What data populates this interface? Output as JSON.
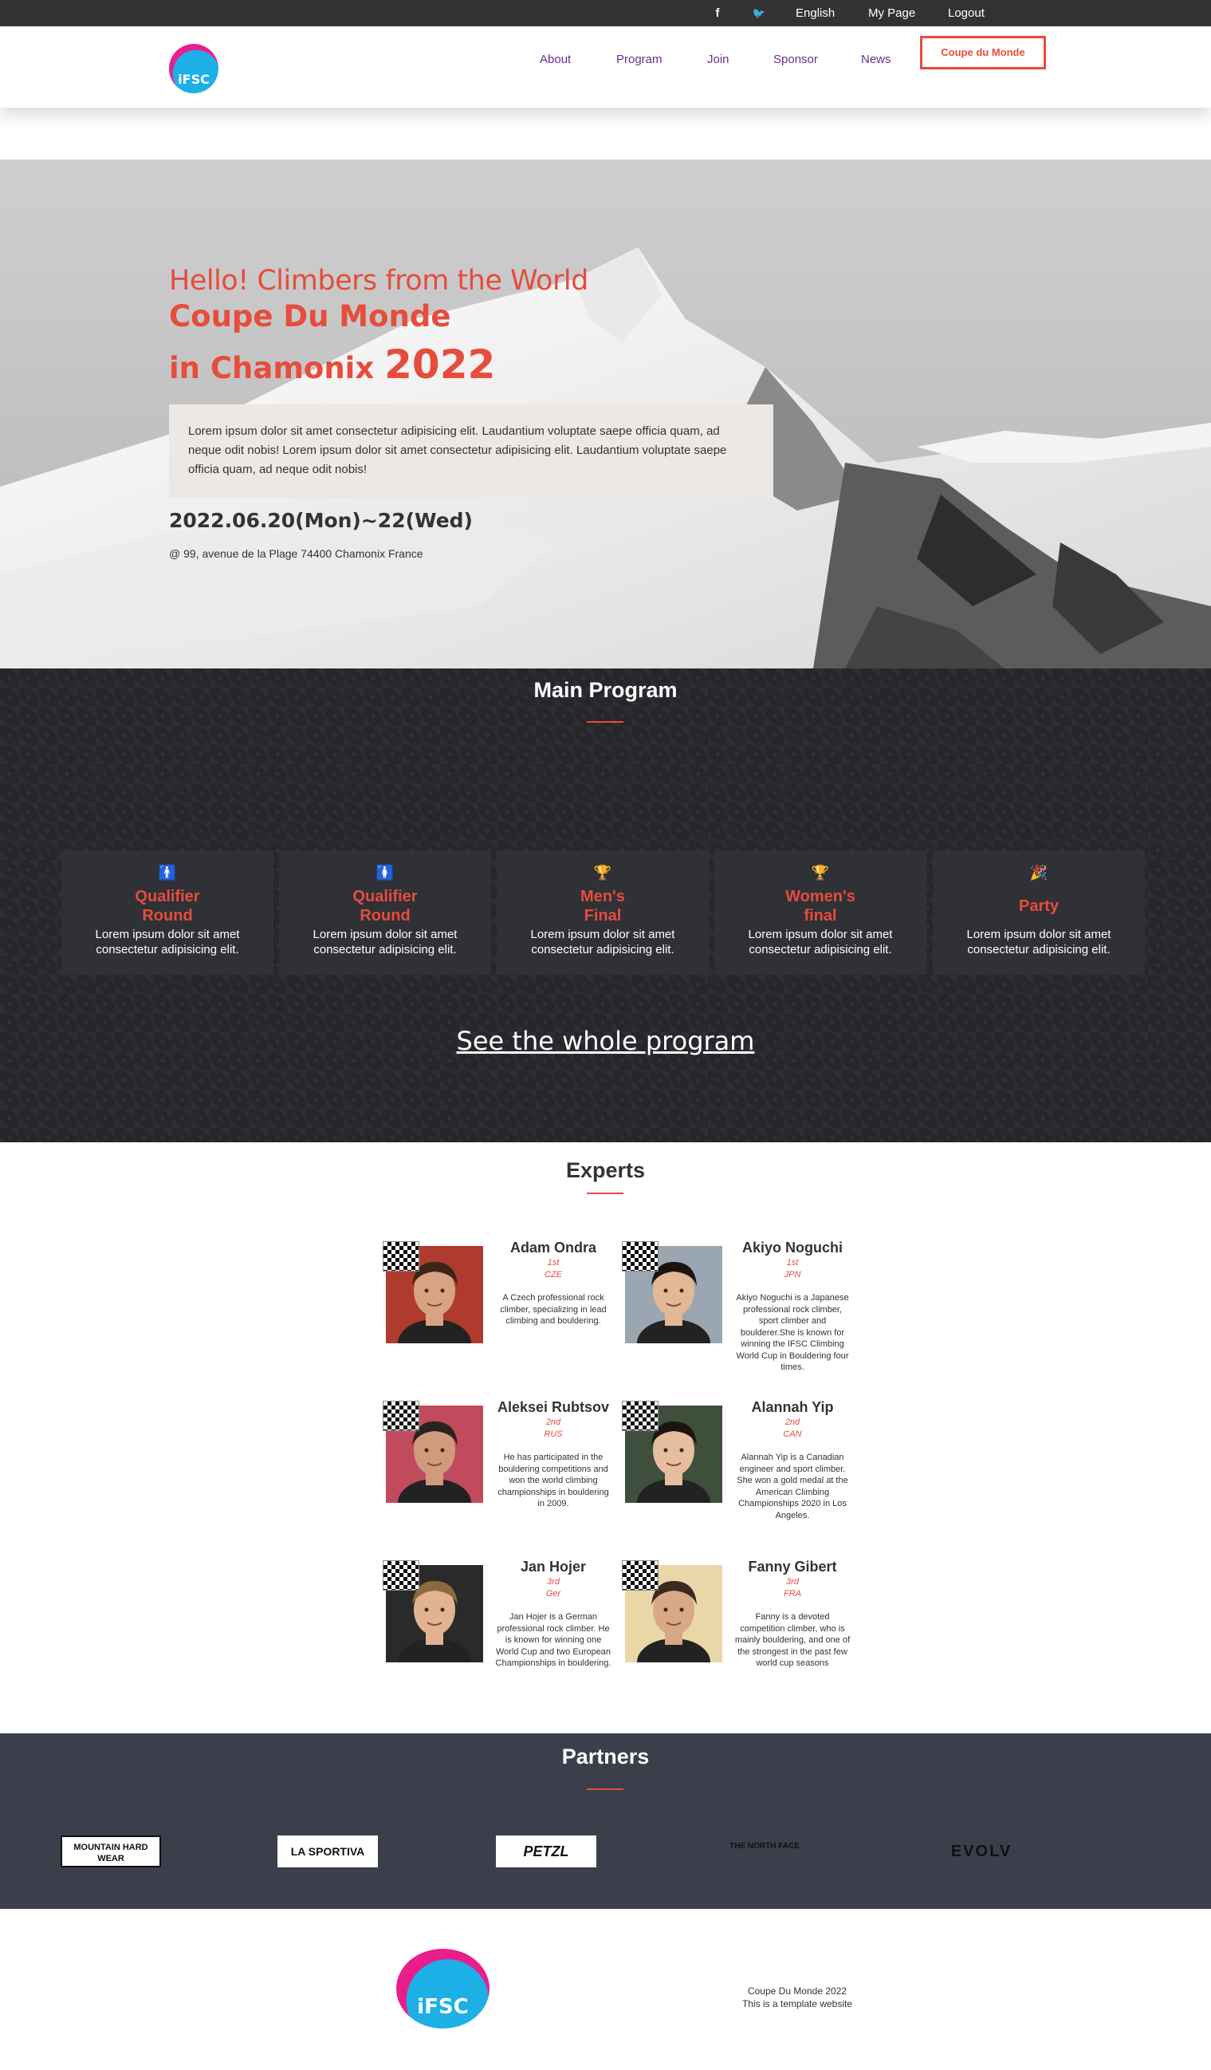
{
  "topbar": {
    "social": [
      {
        "icon": "facebook-icon",
        "glyph": "f"
      },
      {
        "icon": "twitter-icon",
        "glyph": "🐦"
      }
    ],
    "language": "English",
    "my_page": "My Page",
    "logout": "Logout"
  },
  "header": {
    "logo_text": "iFSC",
    "nav": [
      "About",
      "Program",
      "Join",
      "Sponsor",
      "News"
    ],
    "cta": "Coupe du Monde"
  },
  "hero": {
    "line1": "Hello! Climbers from the World",
    "line2": "Coupe Du Monde",
    "line3_prefix": "in Chamonix ",
    "line3_year": "2022",
    "intro": "Lorem ipsum dolor sit amet consectetur adipisicing elit. Laudantium voluptate saepe officia quam, ad neque odit nobis! Lorem ipsum dolor sit amet consectetur adipisicing elit. Laudantium voluptate saepe officia quam, ad neque odit nobis!",
    "dates": "2022.06.20(Mon)~22(Wed)",
    "address": "@ 99, avenue de la Plage 74400 Chamonix France"
  },
  "program": {
    "title": "Main Program",
    "cards": [
      {
        "icon": "male-icon",
        "glyph": "🚹",
        "title_1": "Qualifier",
        "title_2": "Round",
        "desc": "Lorem ipsum dolor sit amet consectetur adipisicing elit."
      },
      {
        "icon": "female-icon",
        "glyph": "🚺",
        "title_1": "Qualifier",
        "title_2": "Round",
        "desc": "Lorem ipsum dolor sit amet consectetur adipisicing elit."
      },
      {
        "icon": "trophy-icon",
        "glyph": "🏆",
        "title_1": "Men's",
        "title_2": "Final",
        "desc": "Lorem ipsum dolor sit amet consectetur adipisicing elit."
      },
      {
        "icon": "trophy-icon",
        "glyph": "🏆",
        "title_1": "Women's",
        "title_2": "final",
        "desc": "Lorem ipsum dolor sit amet consectetur adipisicing elit."
      },
      {
        "icon": "party-icon",
        "glyph": "🎉",
        "title_1": "Party",
        "title_2": "",
        "desc": "Lorem ipsum dolor sit amet consectetur adipisicing elit."
      }
    ],
    "see_all": "See the whole program"
  },
  "experts": {
    "title": "Experts",
    "people": [
      {
        "name": "Adam Ondra",
        "rank": "1st",
        "country": "CZE",
        "bio": "A Czech professional rock climber, specializing in lead climbing and bouldering.",
        "skin": "#d7a382",
        "hair": "#3b2418",
        "bg": "#b03a2e"
      },
      {
        "name": "Akiyo Noguchi",
        "rank": "1st",
        "country": "JPN",
        "bio": "Akiyo Noguchi is a Japanese professional rock climber, sport climber and boulderer.She is known for winning the IFSC Climbing World Cup in Bouldering four times.",
        "skin": "#e2b897",
        "hair": "#1a1411",
        "bg": "#9aa7b2"
      },
      {
        "name": "Aleksei Rubtsov",
        "rank": "2nd",
        "country": "RUS",
        "bio": "He has participated in the bouldering competitions and won the world climbing championships in bouldering in 2009.",
        "skin": "#cf9b7c",
        "hair": "#2a2220",
        "bg": "#c24a5d"
      },
      {
        "name": "Alannah Yip",
        "rank": "2nd",
        "country": "CAN",
        "bio": "Alannah Yip is a Canadian engineer and sport climber. She won a gold medal at the American Climbing Championships 2020 in Los Angeles.",
        "skin": "#e6bd9f",
        "hair": "#1b1512",
        "bg": "#3e4f3c"
      },
      {
        "name": "Jan Hojer",
        "rank": "3rd",
        "country": "Ger",
        "bio": "Jan Hojer is a German professional rock climber. He is known for winning one World Cup and two European Championships in bouldering.",
        "skin": "#e2b393",
        "hair": "#8a6a3e",
        "bg": "#2a2a2a"
      },
      {
        "name": "Fanny Gibert",
        "rank": "3rd",
        "country": "FRA",
        "bio": "Fanny is a devoted competition climber, who is mainly bouldering, and one of the strongest in the past few world cup seasons",
        "skin": "#d9a886",
        "hair": "#3a2a20",
        "bg": "#e9d7a8"
      }
    ]
  },
  "partners": {
    "title": "Partners",
    "logos": [
      "MOUNTAIN HARD WEAR",
      "LA SPORTIVA",
      "PETZL",
      "THE NORTH FACE",
      "EVOLV"
    ]
  },
  "footer": {
    "logo_text": "iFSC",
    "line1": "Coupe Du Monde 2022",
    "line2": "This is a template website"
  },
  "colors": {
    "accent": "#e74c3c",
    "nav": "#6a2c91",
    "dark": "#26272b",
    "partners_bg": "#3b3e4b"
  }
}
